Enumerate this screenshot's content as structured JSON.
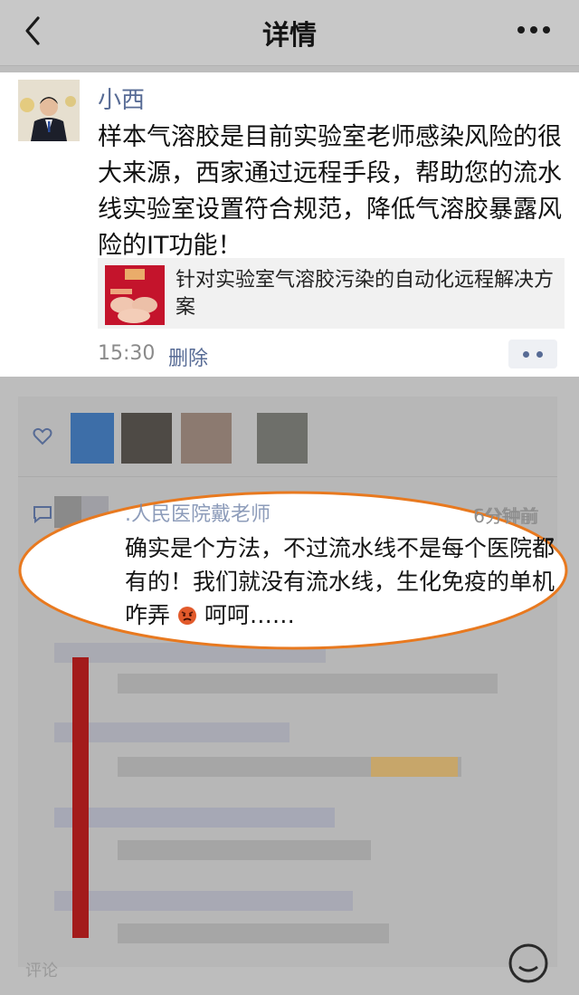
{
  "navbar": {
    "title": "详情",
    "back_icon": "chevron-left-icon",
    "more_icon": "more-dots-icon"
  },
  "post": {
    "author": "小西",
    "text": "样本气溶胶是目前实验室老师感染风险的很大来源，西家通过远程手段，帮助您的流水线实验室设置符合规范，降低气溶胶暴露风险的IT功能！",
    "link_title": "针对实验室气溶胶污染的自动化远程解决方案",
    "time": "15:30",
    "delete_label": "删除",
    "action_icon": "two-dots-icon"
  },
  "feedback": {
    "like_icon": "heart-outline-icon",
    "comment_icon": "comment-bubble-icon",
    "comment": {
      "author": ".人民医院戴老师",
      "time": "6分钟前",
      "text_before_emoji": "确实是个方法，不过流水线不是每个医院都有的！我们就没有流水线，生化免疫的单机咋弄",
      "emoji_icon": "angry-face-emoji-icon",
      "text_after_emoji": "呵呵……"
    },
    "input_placeholder": "评论"
  },
  "colors": {
    "link_blue": "#576b95",
    "highlight_orange": "#e8791f",
    "overlay_gray": "#bdbdbd"
  }
}
